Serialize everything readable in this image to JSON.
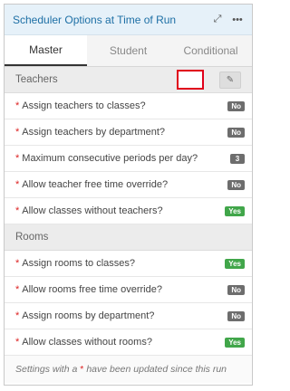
{
  "header": {
    "title": "Scheduler Options at Time of Run",
    "expand_icon": "expand-icon",
    "more_icon": "more-icon"
  },
  "tabs": [
    {
      "label": "Master",
      "active": true
    },
    {
      "label": "Student",
      "active": false
    },
    {
      "label": "Conditional",
      "active": false
    }
  ],
  "teachers": {
    "title": "Teachers",
    "edit_icon": "pencil-icon",
    "rows": [
      {
        "label": "Assign teachers to classes?",
        "value": "No"
      },
      {
        "label": "Assign teachers by department?",
        "value": "No"
      },
      {
        "label": "Maximum consecutive periods per day?",
        "value": "3"
      },
      {
        "label": "Allow teacher free time override?",
        "value": "No"
      },
      {
        "label": "Allow classes without teachers?",
        "value": "Yes"
      }
    ]
  },
  "rooms": {
    "title": "Rooms",
    "rows": [
      {
        "label": "Assign rooms to classes?",
        "value": "Yes"
      },
      {
        "label": "Allow rooms free time override?",
        "value": "No"
      },
      {
        "label": "Assign rooms by department?",
        "value": "No"
      },
      {
        "label": "Allow classes without rooms?",
        "value": "Yes"
      }
    ]
  },
  "footer": {
    "prefix": "Settings with a ",
    "star": "*",
    "suffix": " have been updated since this run"
  },
  "colors": {
    "yes": "#41a64a",
    "no": "#6d6d6d",
    "star": "#dd2222",
    "highlight": "#e0001b"
  }
}
